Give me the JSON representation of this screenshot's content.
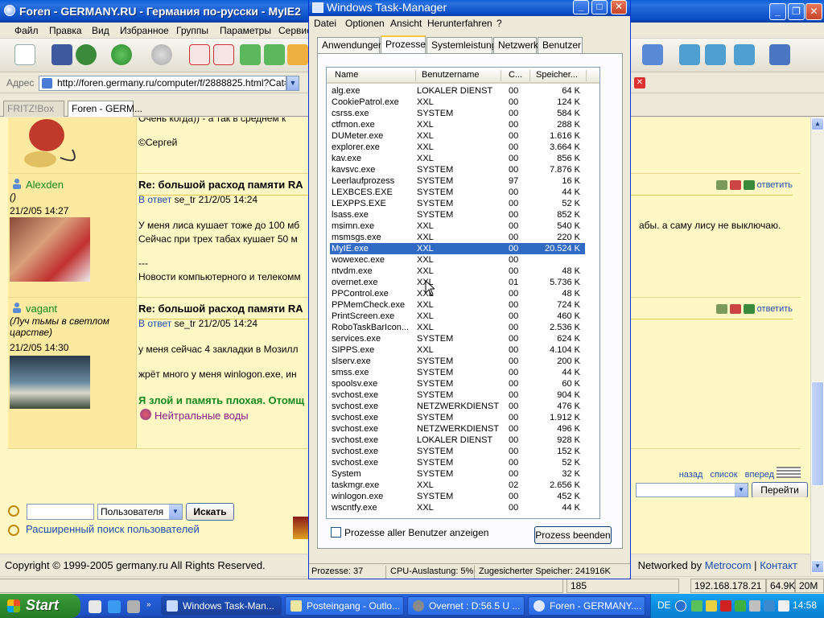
{
  "browser": {
    "title": "Foren - GERMANY.RU - Германия по-русски - MyIE2",
    "menu": [
      "Файл",
      "Правка",
      "Вид",
      "Избранное",
      "Группы",
      "Параметры",
      "Сервис"
    ],
    "address_label": "Адрес",
    "address_value": "http://foren.germany.ru/computer/f/2888825.html?Cat=i",
    "tabs": [
      {
        "label": "FRITZ!Box",
        "active": false
      },
      {
        "label": "Foren - GERM...",
        "active": true
      }
    ]
  },
  "posts": [
    {
      "author": "",
      "status": "",
      "date": "",
      "title": "",
      "reply_prefix": "",
      "reply_to": "",
      "reply_date": "",
      "lines": [
        "Очень когда)) - а так в среднем к",
        "©Сергей"
      ]
    },
    {
      "author": "Alexden",
      "status": "()",
      "date": "21/2/05 14:27",
      "title": "Re: большой расход памяти RA",
      "reply_prefix": "В ответ",
      "reply_to": "se_tr",
      "reply_date": "21/2/05 14:24",
      "lines": [
        "У меня лиса кушает тоже до 100 мб",
        "Сейчас при трех табах кушает 50 м",
        "---",
        "Новости компьютерного и телекомм"
      ],
      "right_tail": "абы. а саму лису не выключаю."
    },
    {
      "author": "vagant",
      "status": "(Луч тьмы в светлом царстве)",
      "date": "21/2/05 14:30",
      "title": "Re: большой расход памяти RA",
      "reply_prefix": "В ответ",
      "reply_to": "se_tr",
      "reply_date": "21/2/05 14:24",
      "lines": [
        "у меня сейчас 4 закладки в Мозилл",
        "жрёт много у меня winlogon.exe, ин",
        "Я злой и память плохая. Отомщ",
        "Нейтральные воды"
      ]
    }
  ],
  "post_action_reply": "ответить",
  "nav_links": [
    "назад",
    "список",
    "вперед"
  ],
  "goto_button": "Перейти",
  "search": {
    "select_value": "Пользователя",
    "button": "Искать",
    "advanced": "Расширенный поиск пользователей"
  },
  "footer": {
    "copyright": "Copyright © 1999-2005 germany.ru All Rights Reserved.",
    "networked_prefix": "Networked by",
    "networked_link": "Metrocom",
    "contact": "Контакт"
  },
  "browser_status": {
    "count": "185",
    "ip": "192.168.178.21",
    "speed": "64.9K",
    "mem": "20M"
  },
  "taskmgr": {
    "title": "Windows Task-Manager",
    "menu": [
      "Datei",
      "Optionen",
      "Ansicht",
      "Herunterfahren",
      "?"
    ],
    "tabs": [
      {
        "label": "Anwendungen",
        "active": false
      },
      {
        "label": "Prozesse",
        "active": true
      },
      {
        "label": "Systemleistung",
        "active": false
      },
      {
        "label": "Netzwerk",
        "active": false
      },
      {
        "label": "Benutzer",
        "active": false
      }
    ],
    "columns": [
      "Name",
      "Benutzername",
      "C...",
      "Speicher..."
    ],
    "selected": "MyIE.exe",
    "processes": [
      [
        "alg.exe",
        "LOKALER DIENST",
        "00",
        "64 K"
      ],
      [
        "CookiePatrol.exe",
        "XXL",
        "00",
        "124 K"
      ],
      [
        "csrss.exe",
        "SYSTEM",
        "00",
        "584 K"
      ],
      [
        "ctfmon.exe",
        "XXL",
        "00",
        "288 K"
      ],
      [
        "DUMeter.exe",
        "XXL",
        "00",
        "1.616 K"
      ],
      [
        "explorer.exe",
        "XXL",
        "00",
        "3.664 K"
      ],
      [
        "kav.exe",
        "XXL",
        "00",
        "856 K"
      ],
      [
        "kavsvc.exe",
        "SYSTEM",
        "00",
        "7.876 K"
      ],
      [
        "Leerlaufprozess",
        "SYSTEM",
        "97",
        "16 K"
      ],
      [
        "LEXBCES.EXE",
        "SYSTEM",
        "00",
        "44 K"
      ],
      [
        "LEXPPS.EXE",
        "SYSTEM",
        "00",
        "52 K"
      ],
      [
        "lsass.exe",
        "SYSTEM",
        "00",
        "852 K"
      ],
      [
        "msimn.exe",
        "XXL",
        "00",
        "540 K"
      ],
      [
        "msmsgs.exe",
        "XXL",
        "00",
        "220 K"
      ],
      [
        "MyIE.exe",
        "XXL",
        "00",
        "20.524 K"
      ],
      [
        "  wowexec.exe",
        "XXL",
        "00",
        ""
      ],
      [
        "ntvdm.exe",
        "XXL",
        "00",
        "48 K"
      ],
      [
        "overnet.exe",
        "XXL",
        "01",
        "5.736 K"
      ],
      [
        "PPControl.exe",
        "XXL",
        "00",
        "48 K"
      ],
      [
        "PPMemCheck.exe",
        "XXL",
        "00",
        "724 K"
      ],
      [
        "PrintScreen.exe",
        "XXL",
        "00",
        "460 K"
      ],
      [
        "RoboTaskBarIcon...",
        "XXL",
        "00",
        "2.536 K"
      ],
      [
        "services.exe",
        "SYSTEM",
        "00",
        "624 K"
      ],
      [
        "SIPPS.exe",
        "XXL",
        "00",
        "4.104 K"
      ],
      [
        "slserv.exe",
        "SYSTEM",
        "00",
        "200 K"
      ],
      [
        "smss.exe",
        "SYSTEM",
        "00",
        "44 K"
      ],
      [
        "spoolsv.exe",
        "SYSTEM",
        "00",
        "60 K"
      ],
      [
        "svchost.exe",
        "SYSTEM",
        "00",
        "904 K"
      ],
      [
        "svchost.exe",
        "NETZWERKDIENST",
        "00",
        "476 K"
      ],
      [
        "svchost.exe",
        "SYSTEM",
        "00",
        "1.912 K"
      ],
      [
        "svchost.exe",
        "NETZWERKDIENST",
        "00",
        "496 K"
      ],
      [
        "svchost.exe",
        "LOKALER DIENST",
        "00",
        "928 K"
      ],
      [
        "svchost.exe",
        "SYSTEM",
        "00",
        "152 K"
      ],
      [
        "svchost.exe",
        "SYSTEM",
        "00",
        "52 K"
      ],
      [
        "System",
        "SYSTEM",
        "00",
        "32 K"
      ],
      [
        "taskmgr.exe",
        "XXL",
        "02",
        "2.656 K"
      ],
      [
        "winlogon.exe",
        "SYSTEM",
        "00",
        "452 K"
      ],
      [
        "wscntfy.exe",
        "XXL",
        "00",
        "44 K"
      ]
    ],
    "show_all_label": "Prozesse aller Benutzer anzeigen",
    "end_process": "Prozess beenden",
    "status": {
      "processes": "Prozesse: 37",
      "cpu": "CPU-Auslastung: 5%",
      "commit": "Zugesicherter Speicher: 241916K"
    }
  },
  "taskbar": {
    "start": "Start",
    "tasks": [
      {
        "label": "Windows Task-Man...",
        "active": true
      },
      {
        "label": "Posteingang - Outlo...",
        "active": false
      },
      {
        "label": "Overnet : D:56.5 U ...",
        "active": false
      },
      {
        "label": "Foren - GERMANY....",
        "active": false
      }
    ],
    "lang": "DE",
    "clock": "14:58"
  },
  "colors": {
    "xp_blue": "#0b4fc6",
    "selection": "#316ac5",
    "forum_bg": "#fff8c4",
    "author_bg": "#fdeaa0",
    "link": "#1a4fb0"
  }
}
